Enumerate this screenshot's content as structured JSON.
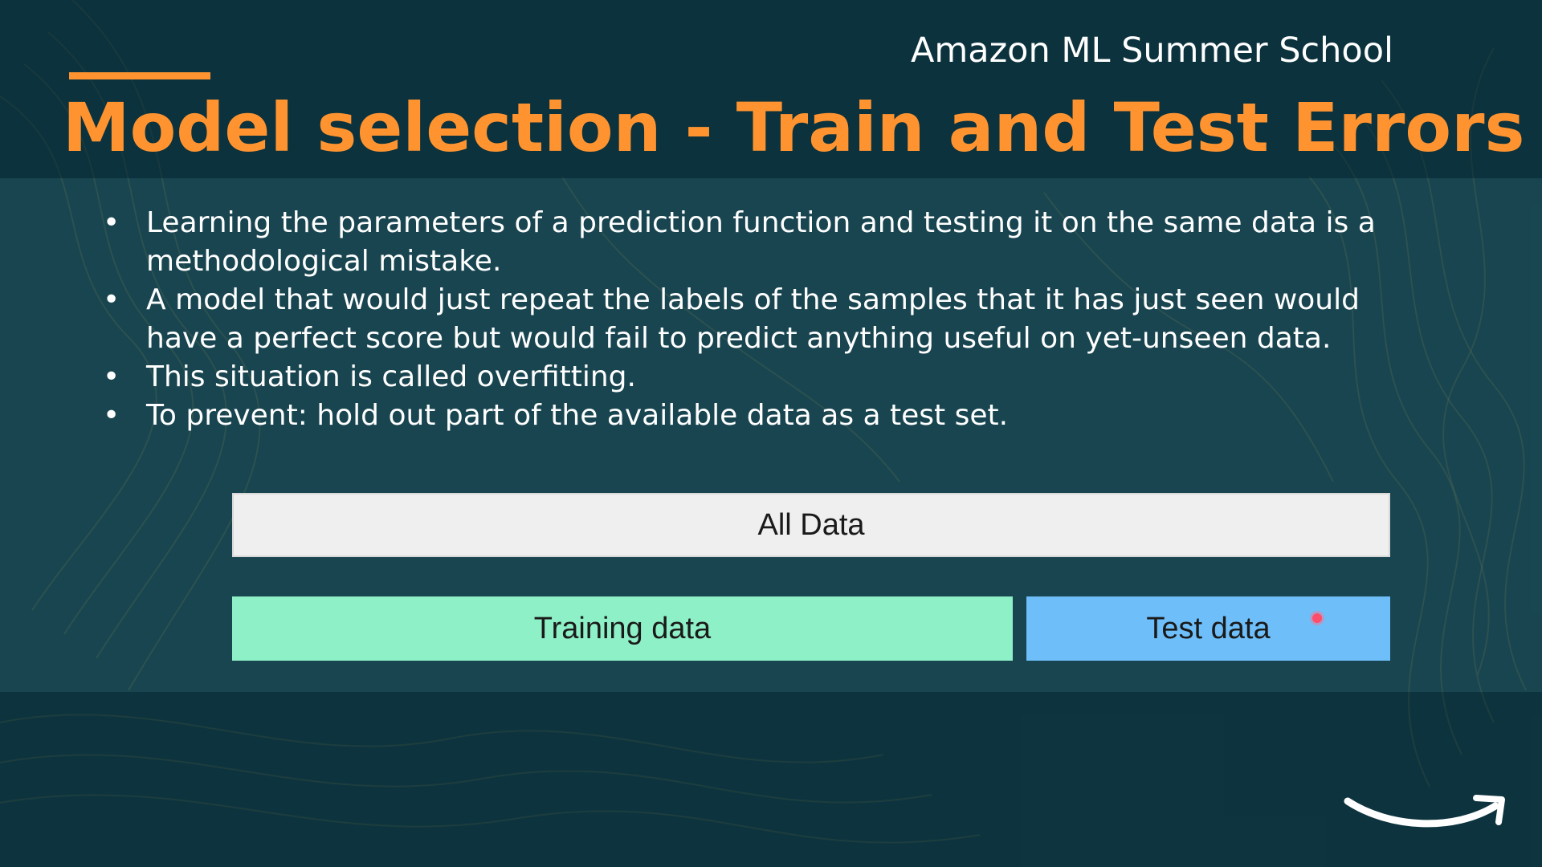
{
  "slide": {
    "school_name": "Amazon ML Summer School",
    "title": "Model selection - Train and Test Errors",
    "bullet_marker": "•",
    "bullets": [
      "Learning the parameters of a prediction function and testing it on the same data is a methodological mistake.",
      "A model that would just repeat the labels of the samples that it has just seen would have a perfect score but would fail to predict anything useful on yet-unseen data.",
      "This situation is called overfitting.",
      "To prevent: hold out part of the available data as a test set."
    ]
  },
  "diagram": {
    "all_data_label": "All Data",
    "training_label": "Training data",
    "test_label": "Test data",
    "colors": {
      "all_data": "#efefef",
      "training": "#8ef0c6",
      "test": "#6ebff9"
    }
  },
  "theme": {
    "background": "#113c48",
    "title_color": "#ff9330",
    "text_color": "#ffffff"
  },
  "icons": {
    "logo": "amazon-smile-logo",
    "pointer": "laser-pointer-dot"
  }
}
